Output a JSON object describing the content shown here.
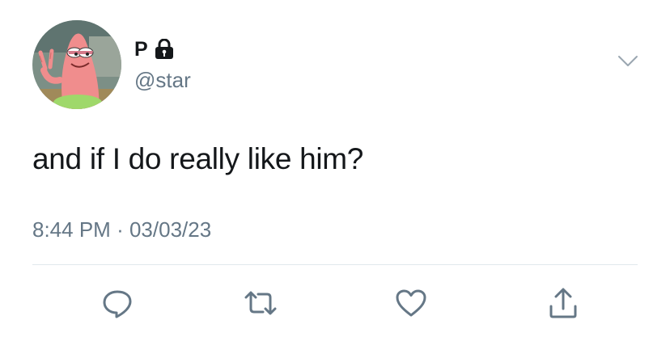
{
  "user": {
    "display_name": "P",
    "handle": "@star",
    "avatar_icon": "avatar",
    "protected_icon": "lock-icon"
  },
  "tweet": {
    "text": "and if I do really like him?",
    "time": "8:44 PM",
    "separator": "·",
    "date": "03/03/23"
  },
  "actions": [
    {
      "name": "reply",
      "icon": "reply-icon"
    },
    {
      "name": "retweet",
      "icon": "retweet-icon"
    },
    {
      "name": "like",
      "icon": "heart-icon"
    },
    {
      "name": "share",
      "icon": "share-icon"
    }
  ],
  "colors": {
    "text": "#14171a",
    "secondary": "#657786",
    "icon": "#657786",
    "divider": "#e1e8ed"
  }
}
